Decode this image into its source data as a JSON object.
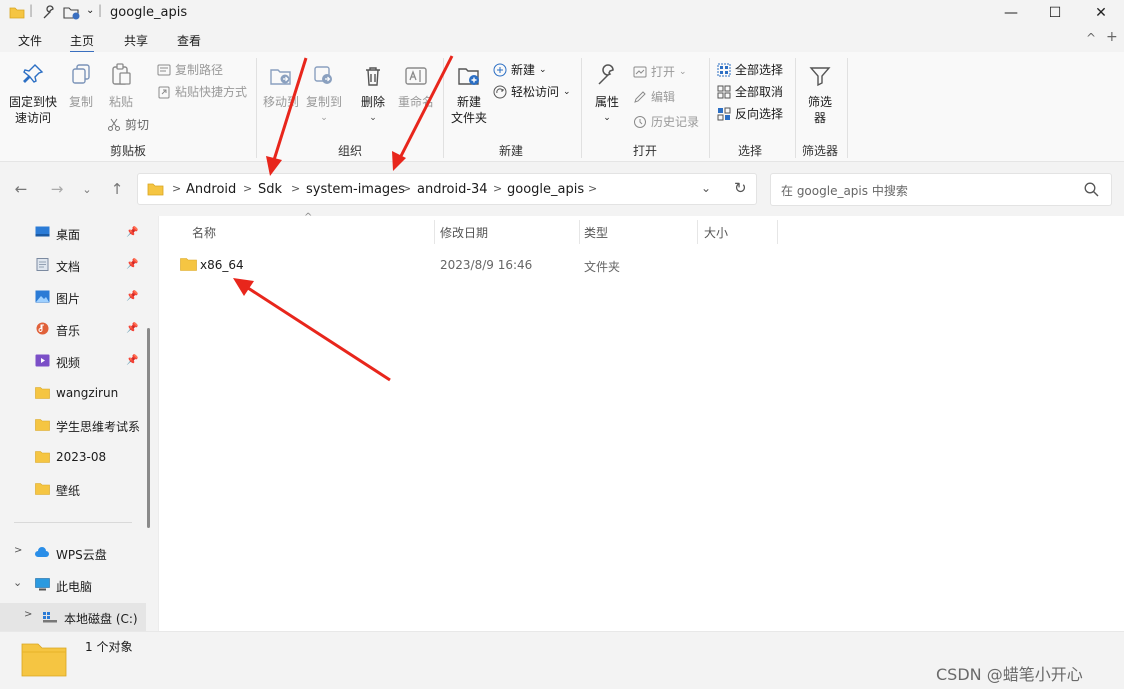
{
  "window": {
    "title": "google_apis",
    "minimize": "—",
    "maximize": "☐",
    "close": "✕"
  },
  "menu": {
    "tabs": [
      "文件",
      "主页",
      "共享",
      "查看"
    ],
    "active_tab": "主页"
  },
  "ribbon": {
    "clipboard": {
      "pin_line1": "固定到快",
      "pin_line2": "速访问",
      "copy": "复制",
      "paste": "粘贴",
      "copy_path": "复制路径",
      "paste_shortcut": "粘贴快捷方式",
      "cut": "剪切",
      "label": "剪贴板"
    },
    "organize": {
      "move_to": "移动到",
      "copy_to": "复制到",
      "delete": "删除",
      "rename": "重命名",
      "label": "组织"
    },
    "new": {
      "new_folder_line1": "新建",
      "new_folder_line2": "文件夹",
      "new_item": "新建",
      "easy_access": "轻松访问",
      "label": "新建"
    },
    "open": {
      "properties": "属性",
      "open": "打开",
      "edit": "编辑",
      "history": "历史记录",
      "label": "打开"
    },
    "select": {
      "select_all": "全部选择",
      "select_none": "全部取消",
      "invert": "反向选择",
      "label": "选择"
    },
    "filter": {
      "filter_line1": "筛选",
      "filter_line2": "器",
      "label": "筛选器"
    }
  },
  "address": {
    "crumbs": [
      "Android",
      "Sdk",
      "system-images",
      "android-34",
      "google_apis"
    ],
    "search_placeholder": "在 google_apis 中搜索"
  },
  "nav": {
    "quick_access": [
      {
        "label": "桌面",
        "pinned": true
      },
      {
        "label": "文档",
        "pinned": true
      },
      {
        "label": "图片",
        "pinned": true
      },
      {
        "label": "音乐",
        "pinned": true
      },
      {
        "label": "视频",
        "pinned": true
      },
      {
        "label": "wangzirun",
        "pinned": false
      },
      {
        "label": "学生思维考试系",
        "pinned": false
      },
      {
        "label": "2023-08",
        "pinned": false
      },
      {
        "label": "壁纸",
        "pinned": false
      }
    ],
    "wps": "WPS云盘",
    "this_pc": "此电脑",
    "local_disk": "本地磁盘 (C:)"
  },
  "columns": {
    "name": "名称",
    "modified": "修改日期",
    "type": "类型",
    "size": "大小"
  },
  "files": [
    {
      "name": "x86_64",
      "modified": "2023/8/9 16:46",
      "type": "文件夹",
      "size": ""
    }
  ],
  "status": {
    "count": "1 个对象"
  },
  "watermark": "CSDN @蜡笔小开心",
  "colors": {
    "accent": "#3a6fbf",
    "folder": "#f5c542",
    "arrow": "#e8261c"
  }
}
